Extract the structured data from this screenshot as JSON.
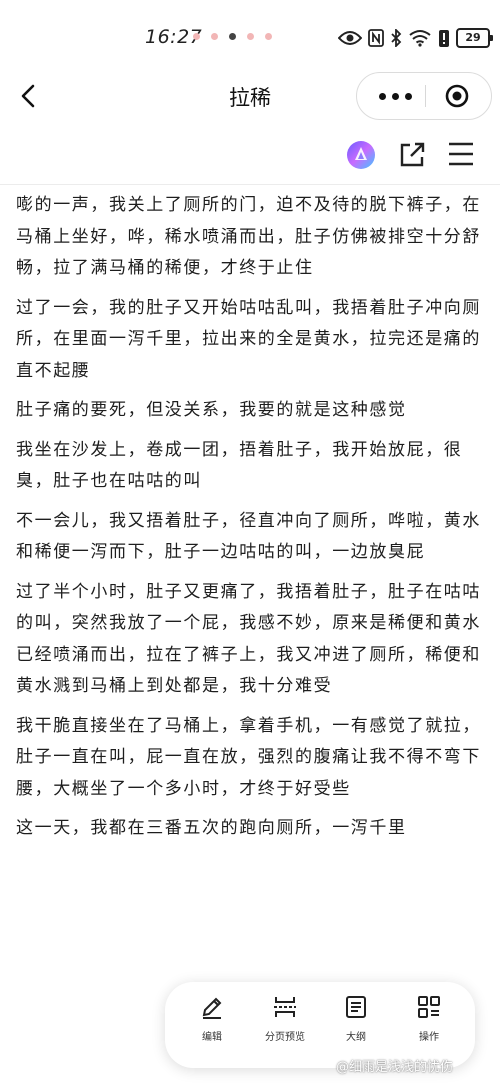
{
  "status_bar": {
    "time": "16:27",
    "battery": "29",
    "icons": [
      "eye-icon",
      "nfc-icon",
      "bluetooth-icon",
      "wifi-icon",
      "battery-alert-icon",
      "battery-icon"
    ]
  },
  "header": {
    "title": "拉稀",
    "back_icon": "chevron-left-icon",
    "more_icon": "more-dots-icon",
    "close_icon": "target-close-icon"
  },
  "toolbar": {
    "icons": [
      "ai-assistant-icon",
      "share-icon",
      "menu-icon"
    ]
  },
  "content": {
    "paragraphs": [
      "嘭的一声，我关上了厕所的门，迫不及待的脱下裤子，在马桶上坐好，哗，稀水喷涌而出，肚子仿佛被排空十分舒畅，拉了满马桶的稀便，才终于止住",
      "过了一会，我的肚子又开始咕咕乱叫，我捂着肚子冲向厕所，在里面一泻千里，拉出来的全是黄水，拉完还是痛的直不起腰",
      "肚子痛的要死，但没关系，我要的就是这种感觉",
      "我坐在沙发上，卷成一团，捂着肚子，我开始放屁，很臭，肚子也在咕咕的叫",
      "不一会儿，我又捂着肚子，径直冲向了厕所，哗啦，黄水和稀便一泻而下，肚子一边咕咕的叫，一边放臭屁",
      "过了半个小时，肚子又更痛了，我捂着肚子，肚子在咕咕的叫，突然我放了一个屁，我感不妙，原来是稀便和黄水已经喷涌而出，拉在了裤子上，我又冲进了厕所，稀便和黄水溅到马桶上到处都是，我十分难受",
      "我干脆直接坐在了马桶上，拿着手机，一有感觉了就拉，肚子一直在叫，屁一直在放，强烈的腹痛让我不得不弯下腰，大概坐了一个多小时，才终于好受些",
      "这一天，我都在三番五次的跑向厕所，一泻千里"
    ]
  },
  "bottom_bar": {
    "items": [
      {
        "label": "编辑",
        "icon": "pencil-icon"
      },
      {
        "label": "分页预览",
        "icon": "page-split-icon"
      },
      {
        "label": "大纲",
        "icon": "outline-list-icon"
      },
      {
        "label": "操作",
        "icon": "grid-operate-icon"
      }
    ]
  },
  "watermark": "@细雨是浅浅的忧伤",
  "colors": {
    "background": "#ffffff",
    "text": "#1e1e1e",
    "ai_gradient": [
      "#6a5cff",
      "#c86bff",
      "#3ec6ff"
    ]
  }
}
